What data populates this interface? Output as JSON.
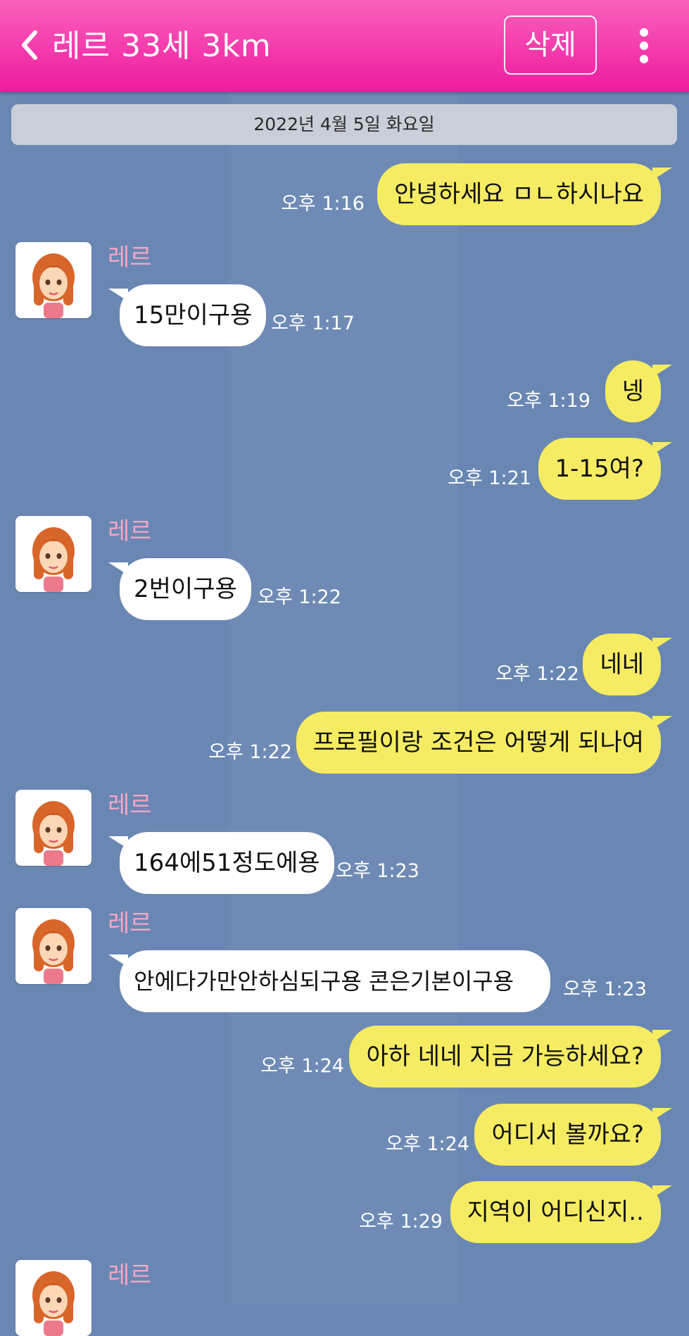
{
  "header": {
    "title": "레르 33세 3km",
    "delete_label": "삭제"
  },
  "date_divider": "2022년 4월 5일 화요일",
  "contact": {
    "name": "레르"
  },
  "messages": [
    {
      "from": "me",
      "text": "안녕하세요 ㅁㄴ하시나요",
      "time": "오후 1:16"
    },
    {
      "from": "them",
      "text": "15만이구용",
      "time": "오후 1:17"
    },
    {
      "from": "me",
      "text": "넹",
      "time": "오후 1:19"
    },
    {
      "from": "me",
      "text": "1-15여?",
      "time": "오후 1:21"
    },
    {
      "from": "them",
      "text": "2번이구용",
      "time": "오후 1:22"
    },
    {
      "from": "me",
      "text": "네네",
      "time": "오후 1:22"
    },
    {
      "from": "me",
      "text": "프로필이랑 조건은 어떻게 되나여",
      "time": "오후 1:22"
    },
    {
      "from": "them",
      "text": "164에51정도에용",
      "time": "오후 1:23"
    },
    {
      "from": "them",
      "text": "안에다가만안하심되구용 콘은기본이구용",
      "time": "오후 1:23"
    },
    {
      "from": "me",
      "text": "아하 네네 지금 가능하세요?",
      "time": "오후 1:24"
    },
    {
      "from": "me",
      "text": "어디서 볼까요?",
      "time": "오후 1:24"
    },
    {
      "from": "me",
      "text": "지역이 어디신지..",
      "time": "오후 1:29"
    }
  ],
  "colors": {
    "header": "#ef1aa0",
    "background": "#6a87b3",
    "my_bubble": "#f6ec63",
    "their_bubble": "#ffffff",
    "sender_name": "#f6a6c4"
  },
  "icons": [
    "back-chevron-icon",
    "more-vertical-icon",
    "avatar-image"
  ]
}
